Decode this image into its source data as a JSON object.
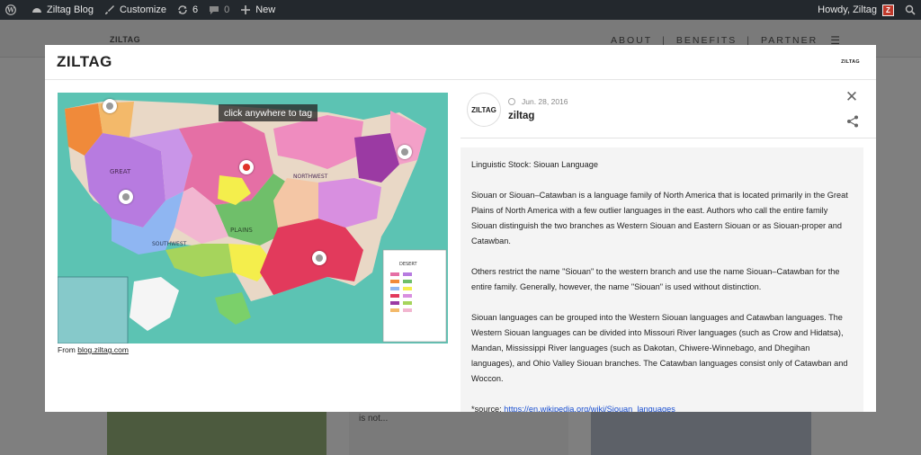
{
  "adminbar": {
    "site_name": "Ziltag Blog",
    "customize_label": "Customize",
    "updates_count": "6",
    "comments_count": "0",
    "new_label": "New",
    "howdy_label": "Howdy, Ziltag"
  },
  "site": {
    "logo": "ZILTAG",
    "nav": [
      "ABOUT",
      "BENEFITS",
      "PARTNER"
    ],
    "bg_excerpt": "is not..."
  },
  "modal": {
    "logo": "ZILTAG",
    "logo_small": "ZILTAG",
    "tooltip": "click anywhere to tag",
    "credit_prefix": "From",
    "credit_link": "blog.ziltag.com",
    "author": {
      "avatar_text": "ZILTAG",
      "date": "Jun. 28, 2016",
      "name": "ziltag"
    },
    "content": {
      "heading": "Linguistic Stock: Siouan Language",
      "p1": "Siouan or Siouan–Catawban is a language family of North America that is located primarily in the Great Plains of North America with a few outlier languages in the east. Authors who call the entire family Siouan distinguish the two branches as Western Siouan and Eastern Siouan or as Siouan-proper and Catawban.",
      "p2": "Others restrict the name \"Siouan\" to the western branch and use the name Siouan–Catawban for the entire family. Generally, however, the name \"Siouan\" is used without distinction.",
      "p3": "Siouan languages can be grouped into the Western Siouan languages and Catawban languages. The Western Siouan languages can be divided into Missouri River languages (such as Crow and Hidatsa), Mandan, Mississippi River languages (such as Dakotan, Chiwere-Winnebago, and Dhegihan languages), and Ohio Valley Siouan branches. The Catawban languages consist only of Catawban and Woccon.",
      "source_prefix": "*source:",
      "source_link": "https://en.wikipedia.org/wiki/Siouan_languages"
    },
    "map_labels": {
      "great": "GREAT",
      "plains": "PLAINS",
      "northwest": "NORTHWEST",
      "southwest": "SOUTHWEST",
      "legend_title": "DESERT"
    }
  },
  "colors": {
    "accent": "#e0332a",
    "adminbar_bg": "#23282d",
    "map_sea": "#58c0b0",
    "link": "#1a4fd0"
  }
}
